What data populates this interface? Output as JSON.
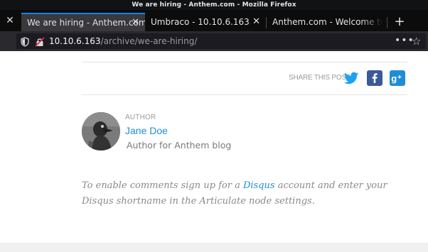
{
  "window": {
    "title": "We are hiring - Anthem.com - Mozilla Firefox"
  },
  "tabs": [
    {
      "label": "We are hiring - Anthem.com",
      "active": true
    },
    {
      "label": "Umbraco - 10.10.6.163",
      "active": false
    },
    {
      "label": "Anthem.com - Welcome to o",
      "active": false
    }
  ],
  "urlbar": {
    "host": "10.10.6.163",
    "path": "/archive/we-are-hiring/"
  },
  "share": {
    "label": "SHARE THIS POST",
    "networks": [
      "twitter-icon",
      "facebook-icon",
      "google-plus-icon"
    ]
  },
  "author": {
    "eyebrow": "AUTHOR",
    "name": "Jane Doe",
    "bio": "Author for Anthem blog"
  },
  "comments": {
    "before": "To enable comments sign up for a ",
    "link": "Disqus",
    "after": " account and enter your Disqus shortname in the Articulate node settings."
  },
  "colors": {
    "accent": "#1f8dd6",
    "tab_highlight": "#0a84ff",
    "twitter": "#1da1f2",
    "facebook": "#3b5998",
    "google": "#1f8dd6"
  }
}
